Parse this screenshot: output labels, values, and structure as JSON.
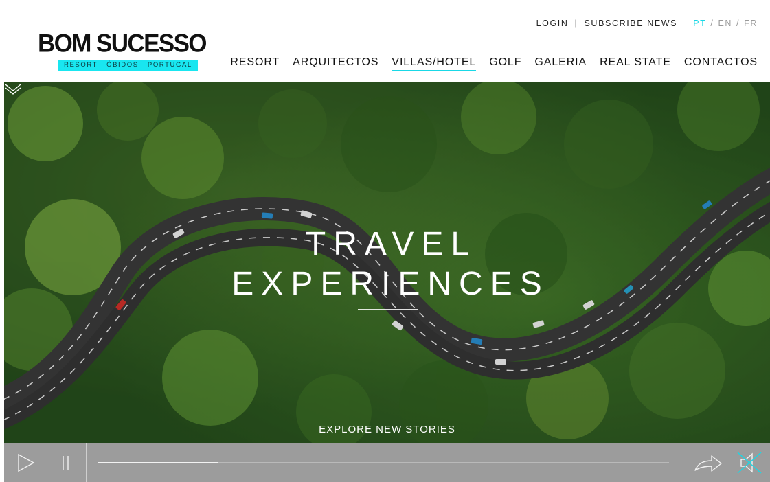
{
  "brand": {
    "name": "BOM SUCESSO",
    "tagline": "RESORT · ÓBIDOS · PORTUGAL",
    "accent": "#19d8e6"
  },
  "topbar": {
    "login": "LOGIN",
    "separator": "|",
    "subscribe": "SUBSCRIBE NEWS",
    "languages": [
      "PT",
      "EN",
      "FR"
    ],
    "active_language": "PT"
  },
  "nav": {
    "items": [
      {
        "label": "RESORT",
        "active": false
      },
      {
        "label": "ARQUITECTOS",
        "active": false
      },
      {
        "label": "VILLAS/HOTEL",
        "active": true
      },
      {
        "label": "GOLF",
        "active": false
      },
      {
        "label": "GALERIA",
        "active": false
      },
      {
        "label": "REAL STATE",
        "active": false
      },
      {
        "label": "CONTACTOS",
        "active": false
      }
    ]
  },
  "hero": {
    "title_line1": "TRAVEL",
    "title_line2": "EXPERIENCES",
    "cta": "EXPLORE NEW STORIES",
    "background": "aerial photo of winding road through forest"
  },
  "player": {
    "progress": 0.21,
    "icons": [
      "play-icon",
      "pause-icon",
      "share-icon",
      "mute-icon"
    ]
  }
}
